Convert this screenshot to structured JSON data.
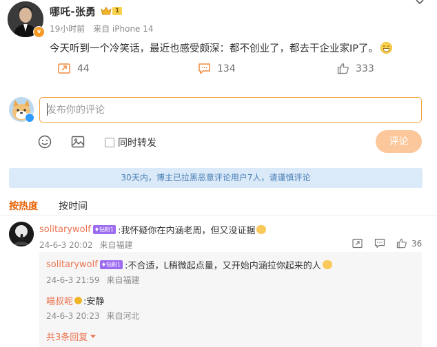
{
  "post": {
    "author": "哪吒-张勇",
    "vip_level": "1",
    "time": "19小时前",
    "source": "来自 iPhone 14",
    "text": "今天听到一个冷笑话，最近也感受颇深：都不创业了，都去干企业家IP了。",
    "reposts": "44",
    "comments": "134",
    "likes": "333"
  },
  "composer": {
    "placeholder": "发布你的评论",
    "repost_label": "同时转发",
    "submit_label": "评论"
  },
  "notice": "30天内，博主已拉黑恶意评论用户7人，请谨慎评论",
  "sort": {
    "hot": "按热度",
    "time": "按时间"
  },
  "comment": {
    "user": "solitarywolf",
    "badge": "钻粉1",
    "text": ":我怀疑你在内涵老周，但又没证据",
    "date": "24-6-3 20:02",
    "location": "来自福建",
    "likes": "36"
  },
  "replies": [
    {
      "user": "solitarywolf",
      "badge": "钻粉1",
      "text": ":不合适，L稍微起点量，又开始内涵拉你起来的人",
      "date": "24-6-3 21:59",
      "location": "来自福建"
    },
    {
      "user": "喵叔呢",
      "text": ":安静",
      "date": "24-6-3 20:23",
      "location": "来自河北"
    }
  ],
  "more_replies": "共3条回复",
  "colors": {
    "accent": "#eb7350",
    "input_border": "#f2a33a",
    "submit_bg": "#fbc79b",
    "notice_bg": "#dbeaf9",
    "notice_text": "#4a7fb5"
  }
}
